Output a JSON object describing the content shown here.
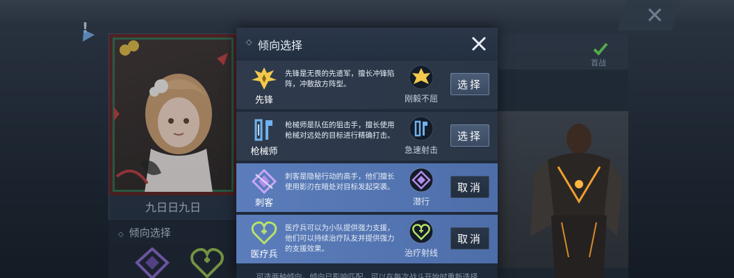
{
  "dialog": {
    "title": "倾向选择",
    "footer": "可选两种倾向，倾向已影响匹配，可以在每次战斗开始时重新选择",
    "rows": [
      {
        "name": "先锋",
        "description": "先锋是无畏的先遣军，擅长冲锋陷阵，冲散敌方阵型。",
        "skill": "刚毅不屈",
        "button": "选择",
        "selected": false
      },
      {
        "name": "枪械师",
        "description": "枪械师是队伍的狙击手，擅长使用枪械对远处的目标进行精确打击。",
        "skill": "急速射击",
        "button": "选择",
        "selected": false
      },
      {
        "name": "刺客",
        "description": "刺客是隐秘行动的高手，他们擅长使用影刃在暗处对目标发起突袭。",
        "skill": "潜行",
        "button": "取消",
        "selected": true
      },
      {
        "name": "医疗兵",
        "description": "医疗兵可以为小队提供强力支援，他们可以持续治疗队友并提供强力的支援效果。",
        "skill": "治疗射线",
        "button": "取消",
        "selected": true
      }
    ]
  },
  "background": {
    "portrait_name": "九日日九日",
    "lower_title": "倾向选择",
    "ready_label": "首战"
  },
  "colors": {
    "accent_gold": "#f2c94c",
    "assassin_purple": "#b48cf0",
    "medic_green": "#b7e36a",
    "gunner_blue": "#6fb3f0",
    "selected_row": "#5b7dbb"
  }
}
